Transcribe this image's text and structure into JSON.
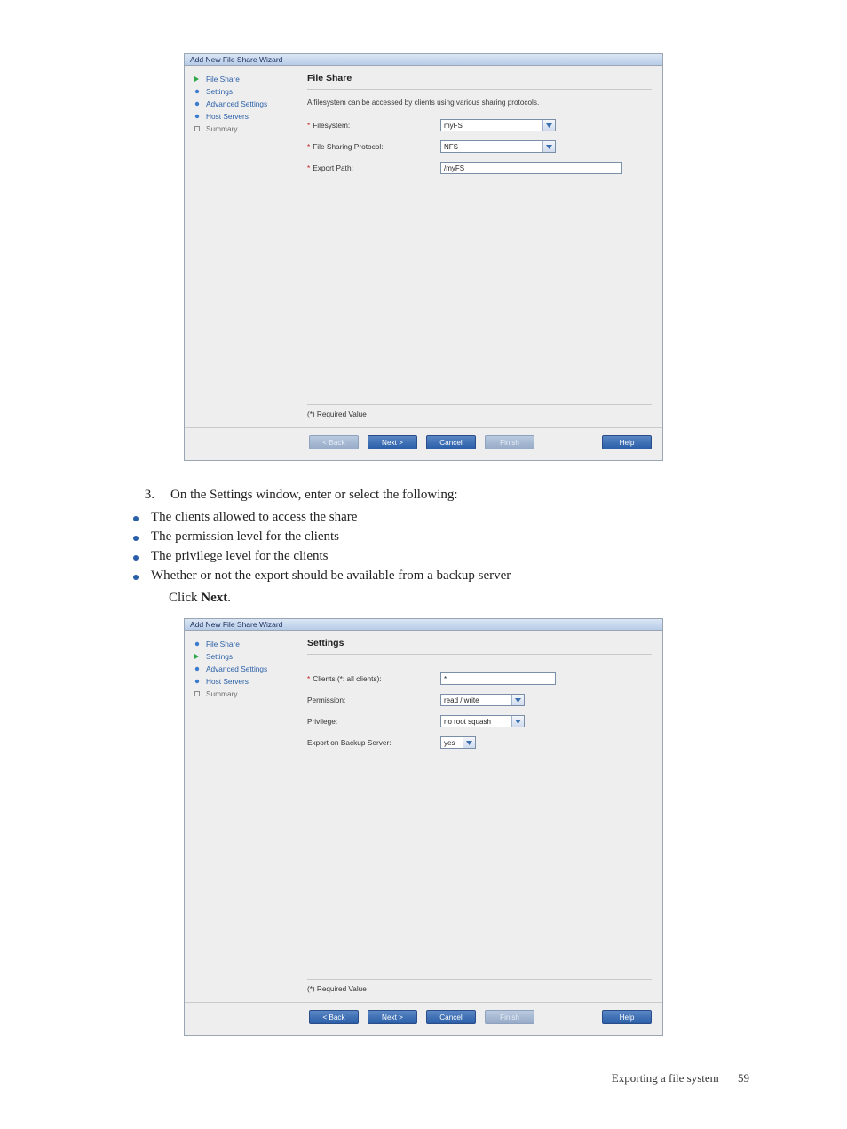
{
  "footer": {
    "label": "Exporting a file system",
    "page": "59"
  },
  "instruction": {
    "step_number": "3.",
    "step_text": "On the Settings window, enter or select the following:",
    "bullets": [
      "The clients allowed to access the share",
      "The permission level for the clients",
      "The privilege level for the clients",
      "Whether or not the export should be available from a backup server"
    ],
    "click": "Click ",
    "click_bold": "Next",
    "click_tail": "."
  },
  "wizard_common": {
    "title": "Add New File Share Wizard",
    "required_note": "(*) Required Value",
    "buttons": {
      "back": "< Back",
      "next": "Next >",
      "cancel": "Cancel",
      "finish": "Finish",
      "help": "Help"
    },
    "nav": {
      "file_share": "File Share",
      "settings": "Settings",
      "advanced_settings": "Advanced Settings",
      "host_servers": "Host Servers",
      "summary": "Summary"
    }
  },
  "wizard1": {
    "heading": "File Share",
    "subheading": "A filesystem can be accessed by clients using various sharing protocols.",
    "fields": {
      "filesystem": {
        "label": "Filesystem:",
        "value": "myFS"
      },
      "protocol": {
        "label": "File Sharing Protocol:",
        "value": "NFS"
      },
      "export": {
        "label": "Export Path:",
        "value": "/myFS"
      }
    }
  },
  "wizard2": {
    "heading": "Settings",
    "fields": {
      "clients": {
        "label": "Clients (*: all clients):",
        "value": "*"
      },
      "permission": {
        "label": "Permission:",
        "value": "read / write"
      },
      "privilege": {
        "label": "Privilege:",
        "value": "no root squash"
      },
      "backup": {
        "label": "Export on Backup Server:",
        "value": "yes"
      }
    }
  }
}
